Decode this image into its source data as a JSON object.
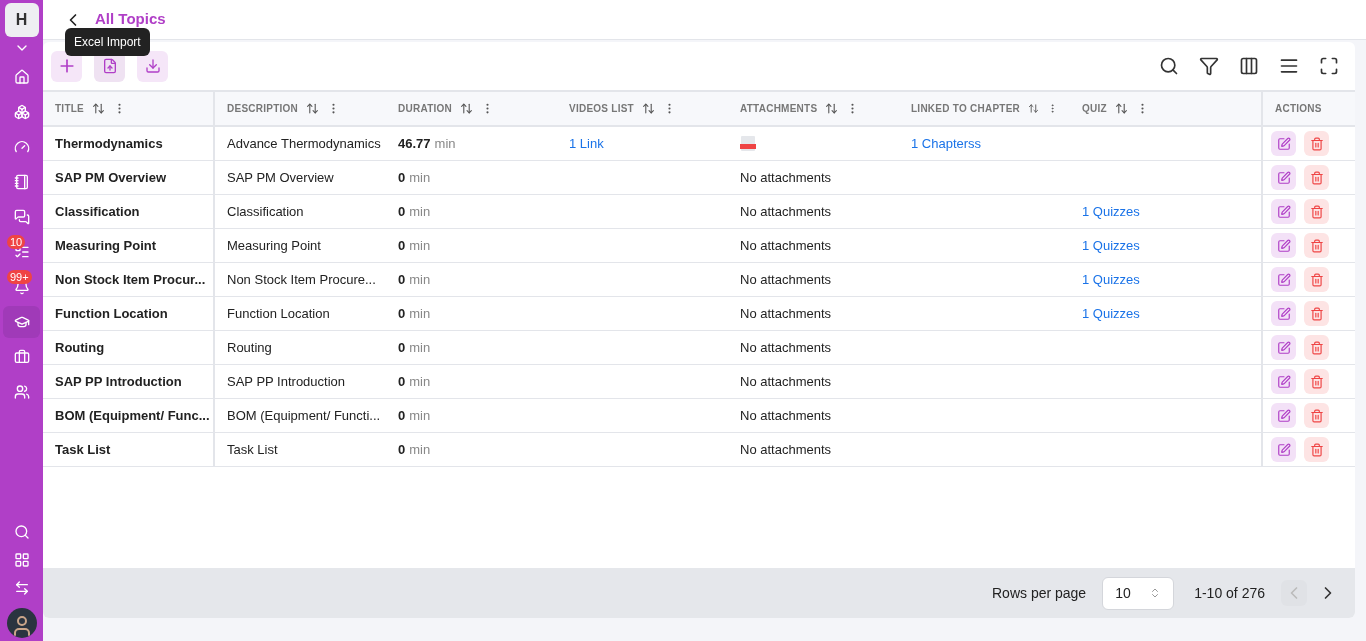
{
  "sidebar": {
    "logo": "H",
    "items": [
      {
        "selected": false
      },
      {
        "selected": false
      },
      {
        "selected": false
      },
      {
        "selected": false
      },
      {
        "selected": false
      },
      {
        "selected": false,
        "badge": "10"
      },
      {
        "selected": false,
        "badge": "99+"
      },
      {
        "selected": true
      },
      {
        "selected": false
      },
      {
        "selected": false
      }
    ]
  },
  "header": {
    "title": "All Topics",
    "tooltip": "Excel Import"
  },
  "table": {
    "columns": [
      {
        "label": "TITLE",
        "sortable": true
      },
      {
        "label": "DESCRIPTION",
        "sortable": true
      },
      {
        "label": "DURATION",
        "sortable": true
      },
      {
        "label": "VIDEOS LIST",
        "sortable": true
      },
      {
        "label": "ATTACHMENTS",
        "sortable": true
      },
      {
        "label": "LINKED TO CHAPTER",
        "sortable": true
      },
      {
        "label": "QUIZ",
        "sortable": true
      },
      {
        "label": "ACTIONS",
        "sortable": false
      }
    ],
    "rows": [
      {
        "title": "Thermodynamics",
        "description": "Advance Thermodynamics",
        "duration": "46.77",
        "unit": "min",
        "videos": "1 Link",
        "attachment": {
          "kind": "pdf"
        },
        "chapter": "1 Chapterss"
      },
      {
        "title": "SAP PM Overview",
        "description": "SAP PM Overview",
        "duration": "0",
        "unit": "min",
        "attachment": {
          "kind": "none",
          "text": "No attachments"
        }
      },
      {
        "title": "Classification",
        "description": "Classification",
        "duration": "0",
        "unit": "min",
        "attachment": {
          "kind": "none",
          "text": "No attachments"
        },
        "quiz": "1 Quizzes"
      },
      {
        "title": "Measuring Point",
        "description": "Measuring Point",
        "duration": "0",
        "unit": "min",
        "attachment": {
          "kind": "none",
          "text": "No attachments"
        },
        "quiz": "1 Quizzes"
      },
      {
        "title": "Non Stock Item Procur...",
        "description": "Non Stock Item Procure...",
        "duration": "0",
        "unit": "min",
        "attachment": {
          "kind": "none",
          "text": "No attachments"
        },
        "quiz": "1 Quizzes"
      },
      {
        "title": "Function Location",
        "description": "Function Location",
        "duration": "0",
        "unit": "min",
        "attachment": {
          "kind": "none",
          "text": "No attachments"
        },
        "quiz": "1 Quizzes"
      },
      {
        "title": "Routing",
        "description": "Routing",
        "duration": "0",
        "unit": "min",
        "attachment": {
          "kind": "none",
          "text": "No attachments"
        }
      },
      {
        "title": "SAP PP Introduction",
        "description": "SAP PP Introduction",
        "duration": "0",
        "unit": "min",
        "attachment": {
          "kind": "none",
          "text": "No attachments"
        }
      },
      {
        "title": "BOM (Equipment/ Func...",
        "description": "BOM (Equipment/ Functi...",
        "duration": "0",
        "unit": "min",
        "attachment": {
          "kind": "none",
          "text": "No attachments"
        }
      },
      {
        "title": "Task List",
        "description": "Task List",
        "duration": "0",
        "unit": "min",
        "attachment": {
          "kind": "none",
          "text": "No attachments"
        }
      }
    ]
  },
  "footer": {
    "rows_label": "Rows per page",
    "rows_value": "10",
    "range": "1-10 of 276",
    "prev_disabled": true
  }
}
